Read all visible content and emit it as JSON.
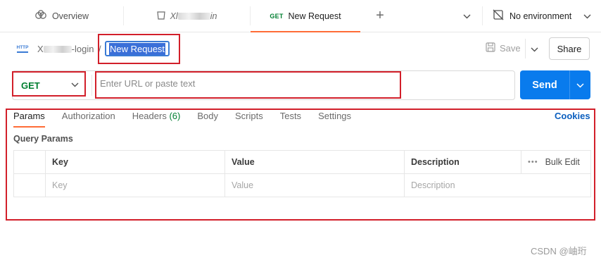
{
  "tabs": {
    "overview": "Overview",
    "collection_prefix": "Xl",
    "collection_suffix": "in",
    "active_method": "GET",
    "active_label": "New Request",
    "add": "+",
    "environment": "No environment"
  },
  "breadcrumb": {
    "collection_prefix": "X",
    "collection_suffix": "-login",
    "separator": "/",
    "request_name": "New Request"
  },
  "toolbar": {
    "save_label": "Save",
    "share_label": "Share"
  },
  "request": {
    "method": "GET",
    "url_value": "",
    "url_placeholder": "Enter URL or paste text",
    "send_label": "Send"
  },
  "subtabs": {
    "params": "Params",
    "authorization": "Authorization",
    "headers": "Headers",
    "headers_count": "(6)",
    "body": "Body",
    "scripts": "Scripts",
    "tests": "Tests",
    "settings": "Settings",
    "cookies": "Cookies"
  },
  "query_params": {
    "title": "Query Params",
    "headers": {
      "key": "Key",
      "value": "Value",
      "description": "Description",
      "bulk_edit": "Bulk Edit"
    },
    "placeholders": {
      "key": "Key",
      "value": "Value",
      "description": "Description"
    }
  },
  "watermark": "CSDN @岫珩",
  "colors": {
    "accent_orange": "#ff6c37",
    "send_blue": "#097bed",
    "get_green": "#007f31",
    "highlight_red": "#d21f2a",
    "link_blue": "#0b5fbf"
  },
  "icons": {
    "overview": "overview-icon",
    "collection": "collection-icon",
    "environment": "no-environment-icon",
    "http": "http-icon",
    "save": "save-icon"
  }
}
